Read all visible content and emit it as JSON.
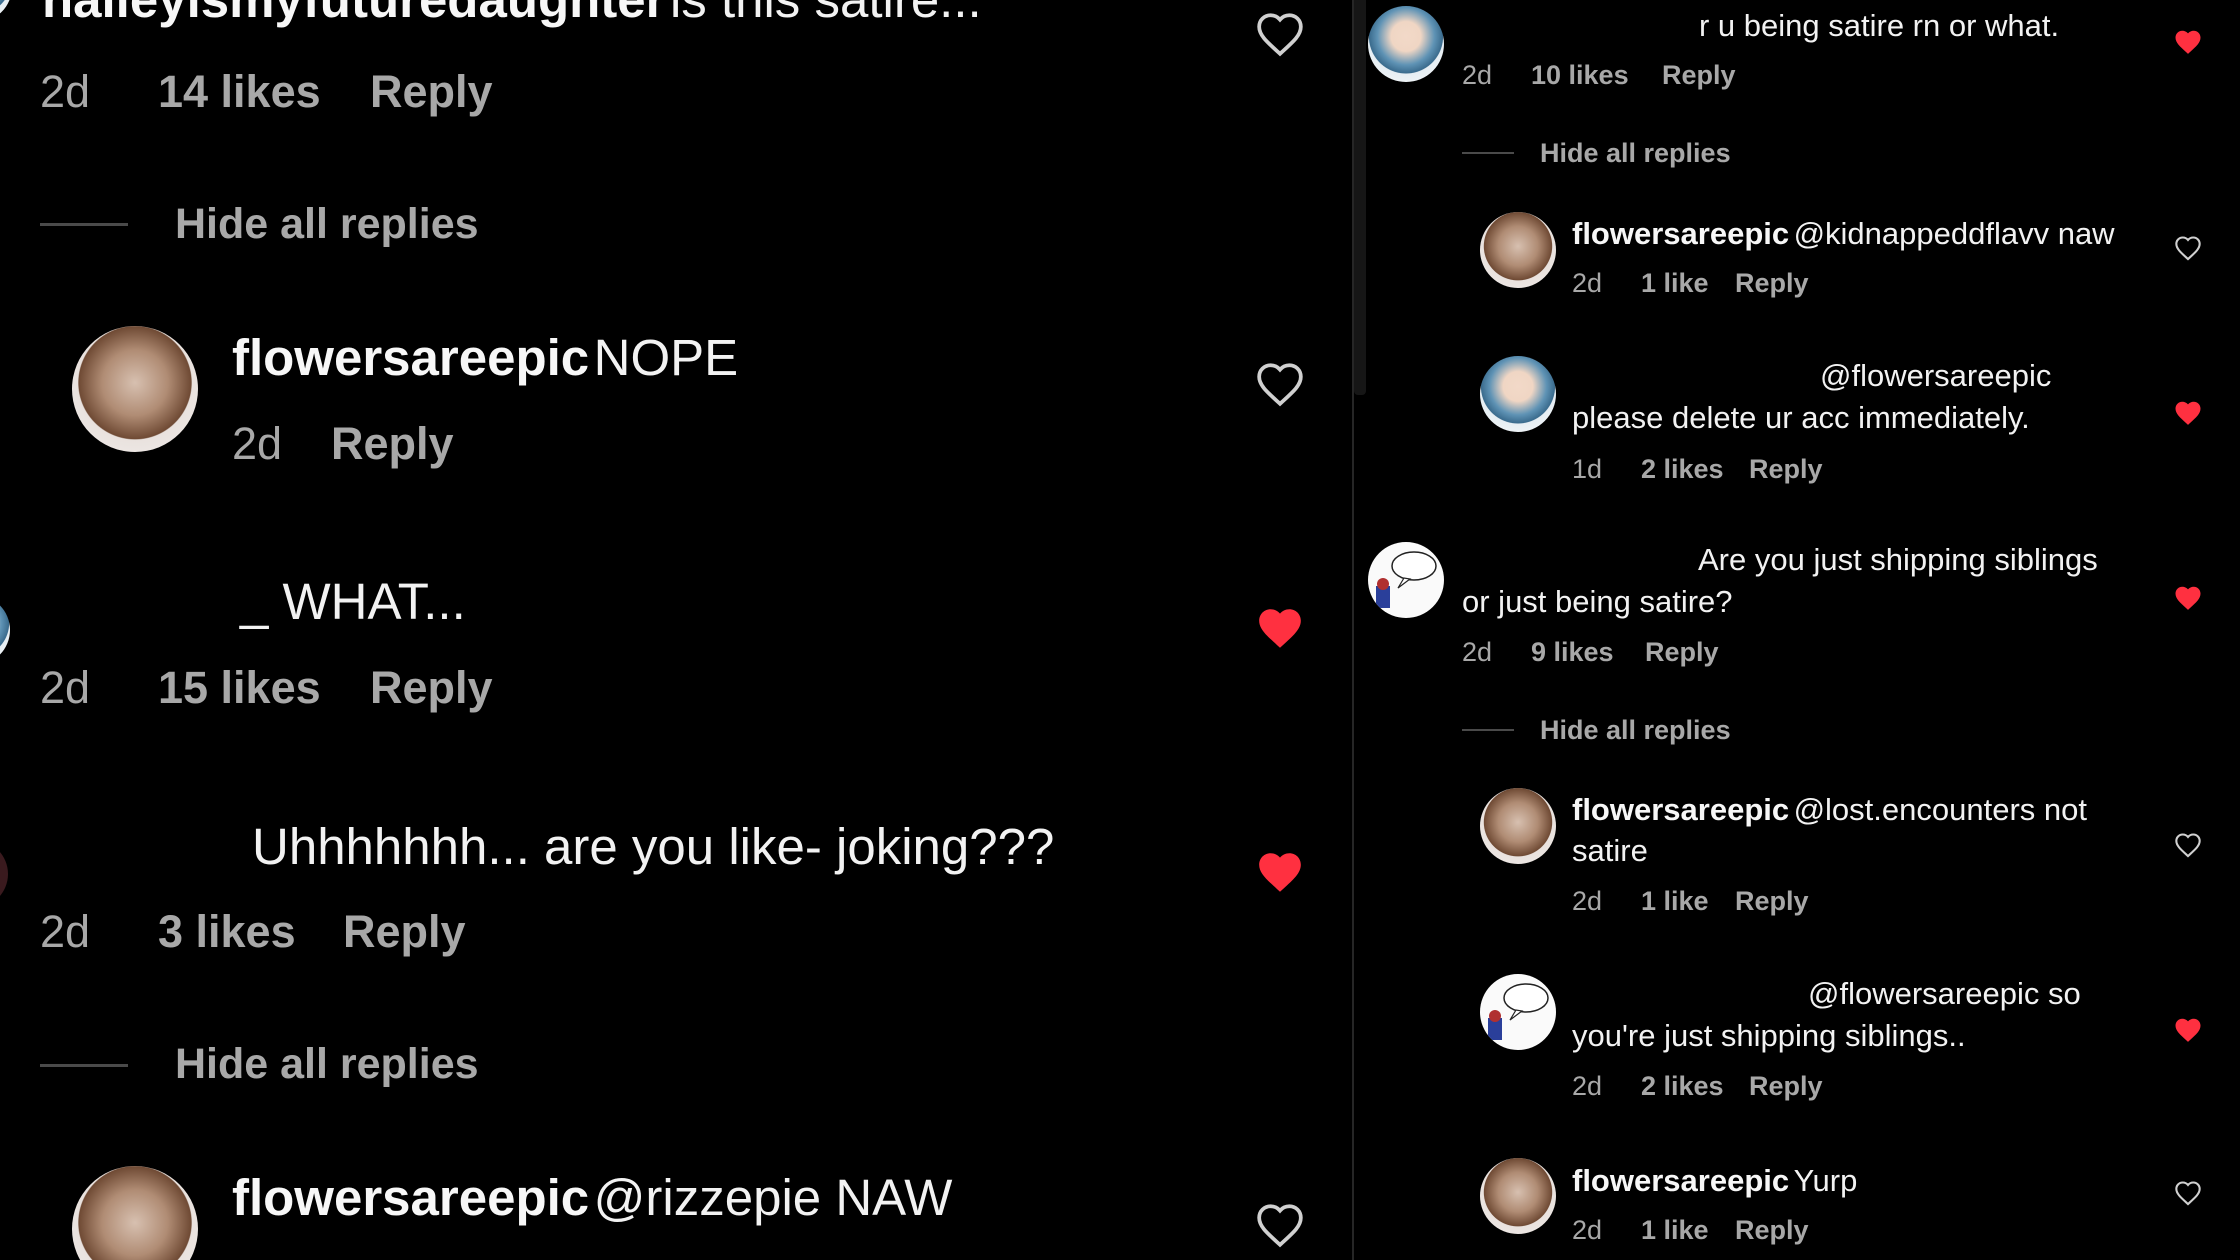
{
  "colors": {
    "background": "#000000",
    "text": "#f2f2f2",
    "meta": "#a8a8a8",
    "liked_heart": "#ff3040",
    "unliked_heart": "#d0d0d0"
  },
  "left": {
    "c1": {
      "username": "halleyismyfuturedaughter",
      "text": "is this satire...",
      "time": "2d",
      "likes": "14 likes",
      "reply": "Reply",
      "heart": "heart-outline-icon"
    },
    "hide1": "Hide all replies",
    "r1": {
      "username": "flowersareepic",
      "text": "NOPE",
      "time": "2d",
      "reply": "Reply",
      "heart": "heart-outline-icon"
    },
    "c2": {
      "text": "_ WHAT...",
      "time": "2d",
      "likes": "15 likes",
      "reply": "Reply",
      "heart": "heart-filled-icon"
    },
    "c3": {
      "text": "Uhhhhhhh... are you like- joking???",
      "time": "2d",
      "likes": "3 likes",
      "reply": "Reply",
      "heart": "heart-filled-icon"
    },
    "hide2": "Hide all replies",
    "r2": {
      "username": "flowersareepic",
      "text": "@rizzepie NAW",
      "heart": "heart-outline-icon"
    }
  },
  "right": {
    "c1": {
      "text": "r u being satire rn or what.",
      "time": "2d",
      "likes": "10 likes",
      "reply": "Reply",
      "heart": "heart-filled-icon"
    },
    "hide1": "Hide all replies",
    "r1": {
      "username": "flowersareepic",
      "text": "@kidnappeddflavv naw",
      "time": "2d",
      "likes": "1 like",
      "reply": "Reply",
      "heart": "heart-outline-icon"
    },
    "r2": {
      "line1": "@flowersareepic",
      "line2": "please delete ur acc immediately.",
      "time": "1d",
      "likes": "2 likes",
      "reply": "Reply",
      "heart": "heart-filled-icon"
    },
    "c2": {
      "line1": "Are you just shipping siblings",
      "line2": "or just being satire?",
      "time": "2d",
      "likes": "9 likes",
      "reply": "Reply",
      "heart": "heart-filled-icon"
    },
    "hide2": "Hide all replies",
    "r3": {
      "username": "flowersareepic",
      "line1": "@lost.encounters not",
      "line2": "satire",
      "time": "2d",
      "likes": "1 like",
      "reply": "Reply",
      "heart": "heart-outline-icon"
    },
    "r4": {
      "line1": "@flowersareepic so",
      "line2": "you're just shipping siblings..",
      "time": "2d",
      "likes": "2 likes",
      "reply": "Reply",
      "heart": "heart-filled-icon"
    },
    "r5": {
      "username": "flowersareepic",
      "text": "Yurp",
      "time": "2d",
      "likes": "1 like",
      "reply": "Reply",
      "heart": "heart-outline-icon"
    }
  }
}
